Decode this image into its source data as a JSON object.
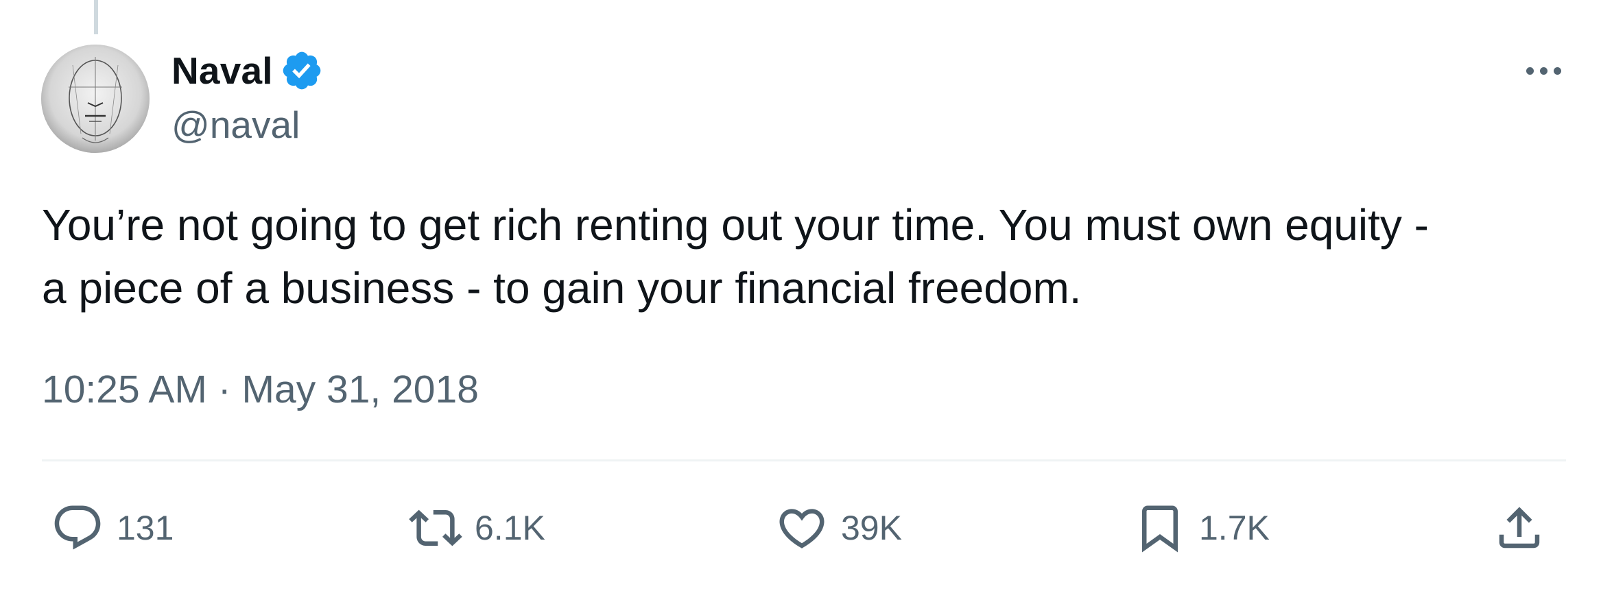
{
  "author": {
    "display_name": "Naval",
    "handle": "@naval",
    "verified": true,
    "verified_color": "#1d9bf0",
    "avatar_icon": "avatar-sketch"
  },
  "tweet": {
    "text": "You’re not going to get rich renting out your time. You must own equity -\na piece of a business - to gain your financial freedom.",
    "time": "10:25 AM",
    "separator": "·",
    "date": "May 31, 2018"
  },
  "actions": {
    "replies": "131",
    "reposts": "6.1K",
    "likes": "39K",
    "bookmarks": "1.7K"
  },
  "colors": {
    "text": "#0f1419",
    "secondary": "#536471",
    "divider": "#eff3f4",
    "thread_line": "#cfd9de"
  }
}
